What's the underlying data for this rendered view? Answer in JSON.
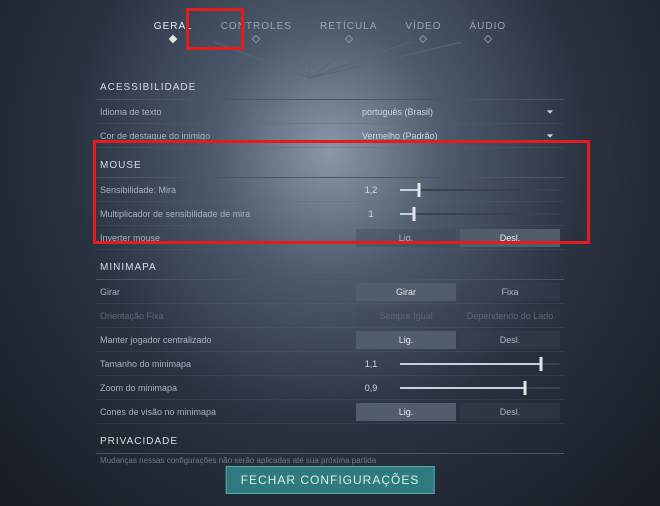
{
  "tabs": {
    "items": [
      {
        "label": "GERAL",
        "active": true
      },
      {
        "label": "CONTROLES",
        "active": false
      },
      {
        "label": "RETÍCULA",
        "active": false
      },
      {
        "label": "VÍDEO",
        "active": false
      },
      {
        "label": "ÁUDIO",
        "active": false
      }
    ]
  },
  "sections": {
    "acessibilidade": {
      "title": "ACESSIBILIDADE",
      "rows": {
        "idioma": {
          "label": "Idioma de texto",
          "value": "português (Brasil)"
        },
        "cor": {
          "label": "Cor de destaque do inimigo",
          "value": "Vermelho (Padrão)"
        }
      }
    },
    "mouse": {
      "title": "MOUSE",
      "rows": {
        "sens": {
          "label": "Sensibilidade: Mira",
          "value": "1,2",
          "pct": 12
        },
        "mult": {
          "label": "Multiplicador de sensibilidade de mira",
          "value": "1",
          "pct": 9
        },
        "invert": {
          "label": "Inverter mouse",
          "on": "Lig.",
          "off": "Desl.",
          "selected": "off"
        }
      }
    },
    "minimapa": {
      "title": "MINIMAPA",
      "rows": {
        "girar": {
          "label": "Girar",
          "a": "Girar",
          "b": "Fixa",
          "selected": "a"
        },
        "orient": {
          "label": "Orientação Fixa",
          "a": "Sempre Igual",
          "b": "Dependendo do Lado",
          "disabled": true
        },
        "center": {
          "label": "Manter jogador centralizado",
          "a": "Lig.",
          "b": "Desl.",
          "selected": "a"
        },
        "size": {
          "label": "Tamanho do minimapa",
          "value": "1,1",
          "pct": 88
        },
        "zoom": {
          "label": "Zoom do minimapa",
          "value": "0,9",
          "pct": 78
        },
        "cones": {
          "label": "Cones de visão no minimapa",
          "a": "Lig.",
          "b": "Desl.",
          "selected": "a"
        }
      }
    },
    "privacidade": {
      "title": "PRIVACIDADE",
      "subtitle": "Mudanças nessas configurações não serão aplicadas até sua próxima partida"
    }
  },
  "close_label": "FECHAR CONFIGURAÇÕES"
}
